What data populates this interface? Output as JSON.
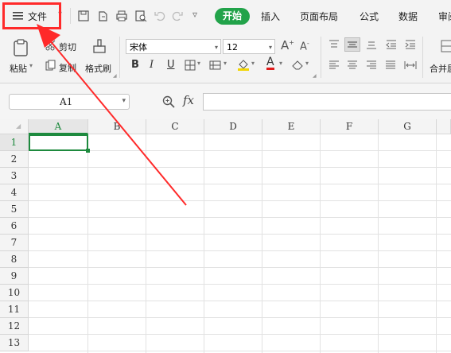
{
  "menu": {
    "file_label": "文件",
    "tabs": [
      "开始",
      "插入",
      "页面布局",
      "公式",
      "数据",
      "审阅"
    ]
  },
  "ribbon": {
    "paste": "粘贴",
    "cut": "剪切",
    "copy": "复制",
    "format_painter": "格式刷",
    "font_name": "宋体",
    "font_size": "12",
    "merge": "合并居中"
  },
  "formula_bar": {
    "cell_ref": "A1",
    "fx": "fx"
  },
  "grid": {
    "columns": [
      "A",
      "B",
      "C",
      "D",
      "E",
      "F",
      "G"
    ],
    "rows": [
      "1",
      "2",
      "3",
      "4",
      "5",
      "6",
      "7",
      "8",
      "9",
      "10",
      "11",
      "12",
      "13"
    ]
  },
  "colors": {
    "accent": "#22a34a",
    "highlight": "#ff2a2a"
  }
}
